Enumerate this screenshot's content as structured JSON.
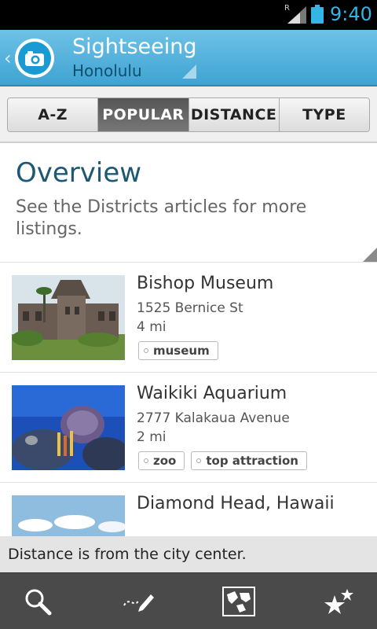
{
  "status_bar": {
    "time": "9:40",
    "roaming": "R"
  },
  "action_bar": {
    "title": "Sightseeing",
    "subtitle": "Honolulu",
    "back_glyph": "‹"
  },
  "tabs": [
    {
      "label": "A-Z",
      "selected": false
    },
    {
      "label": "POPULAR",
      "selected": true
    },
    {
      "label": "DISTANCE",
      "selected": false
    },
    {
      "label": "TYPE",
      "selected": false
    }
  ],
  "overview": {
    "title": "Overview",
    "text": "See the Districts articles for more listings."
  },
  "items": [
    {
      "name": "Bishop Museum",
      "address": "1525 Bernice St",
      "distance": "4 mi",
      "tags": [
        "museum"
      ],
      "image": "museum-building-photo"
    },
    {
      "name": "Waikiki Aquarium",
      "address": "2777 Kalakaua Avenue",
      "distance": "2 mi",
      "tags": [
        "zoo",
        "top attraction"
      ],
      "image": "coral-reef-photo"
    },
    {
      "name": "Diamond Head, Hawaii",
      "address": "",
      "distance": "",
      "tags": [],
      "image": "sky-clouds-photo"
    }
  ],
  "note": "Distance is from the city center.",
  "bottom_bar": {
    "icons": [
      "search-icon",
      "edit-pencil-icon",
      "map-icon",
      "favorites-stars-icon"
    ]
  },
  "colors": {
    "accent": "#33b5e5",
    "actionbar": "#4fb0dc",
    "title_blue": "#1c5873"
  }
}
